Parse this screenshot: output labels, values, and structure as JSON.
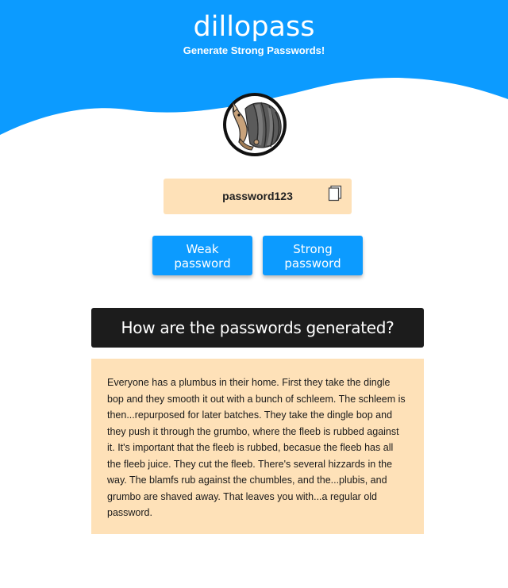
{
  "header": {
    "title": "dillopass",
    "subtitle": "Generate Strong Passwords!"
  },
  "colors": {
    "hero_blue": "#0c9bff",
    "password_bg": "#fee1b8",
    "faq_header_bg": "#1c1c1c",
    "button_text": "#ffffff"
  },
  "logo": {
    "icon": "armadillo-logo-icon"
  },
  "password": {
    "value": "password123",
    "copy_icon": "copy-icon"
  },
  "buttons": {
    "weak_line1": "Weak",
    "weak_line2": "password",
    "strong_line1": "Strong",
    "strong_line2": "password"
  },
  "faq": {
    "heading": "How are the passwords generated?",
    "body": "Everyone has a plumbus in their home. First they take the dingle bop and they smooth it out with a bunch of schleem. The schleem is then...repurposed for later batches. They take the dingle bop and they push it through the grumbo, where the fleeb is rubbed against it. It's important that the fleeb is rubbed, becasue the fleeb has all the fleeb juice. They cut the fleeb. There's several hizzards in the way. The blamfs rub against the chumbles, and the...plubis, and grumbo are shaved away. That leaves you with...a regular old password."
  }
}
